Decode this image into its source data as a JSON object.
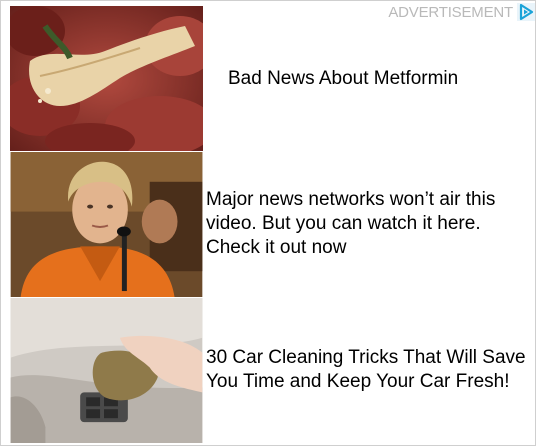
{
  "ad_widget": {
    "label": "ADVERTISEMENT",
    "choices_icon": "adchoices-triangle-icon",
    "accent_color": "#1aa3d8",
    "items": [
      {
        "headline": "Bad News About Metformin",
        "image_icon": "pancreas-organ-photo"
      },
      {
        "headline": "Major news networks won’t air this video. But you can watch it here. Check it out now",
        "image_icon": "woman-orange-jacket-microphone-photo"
      },
      {
        "headline": "30 Car Cleaning Tricks That Will Save You Time and Keep Your Car Fresh!",
        "image_icon": "car-door-cleaning-putty-photo"
      }
    ]
  }
}
